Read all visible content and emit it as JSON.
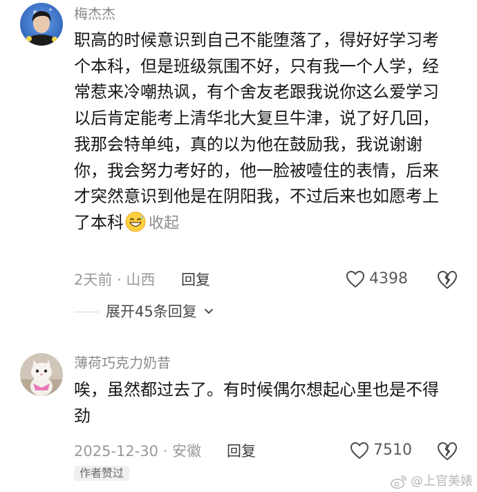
{
  "comments": [
    {
      "username": "梅杰杰",
      "text": "职高的时候意识到自己不能堕落了，得好好学习考个本科，但是班级氛围不好，只有我一个人学，经常惹来冷嘲热讽，有个舍友老跟我说你这么爱学习以后肯定能考上清华北大复旦牛津，说了好几回，我那会特单纯，真的以为他在鼓励我，我说谢谢你，我会努力考好的，他一脸被噎住的表情，后来才突然意识到他是在阴阳我，不过后来也如愿考上了本科",
      "emoji_icon": "grinning-sweat-emoji",
      "collapse_label": "收起",
      "time": "2天前",
      "location": "山西",
      "reply_label": "回复",
      "likes": "4398",
      "expand_label": "展开45条回复"
    },
    {
      "username": "薄荷巧克力奶昔",
      "text": "唉，虽然都过去了。有时候偶尔想起心里也是不得劲",
      "date": "2025-12-30",
      "location": "安徽",
      "reply_label": "回复",
      "likes": "7510",
      "badge": "作者赞过"
    }
  ],
  "watermark": "@上官美婊",
  "colors": {
    "meta_gray": "#9a9a9a",
    "text_black": "#161616"
  }
}
